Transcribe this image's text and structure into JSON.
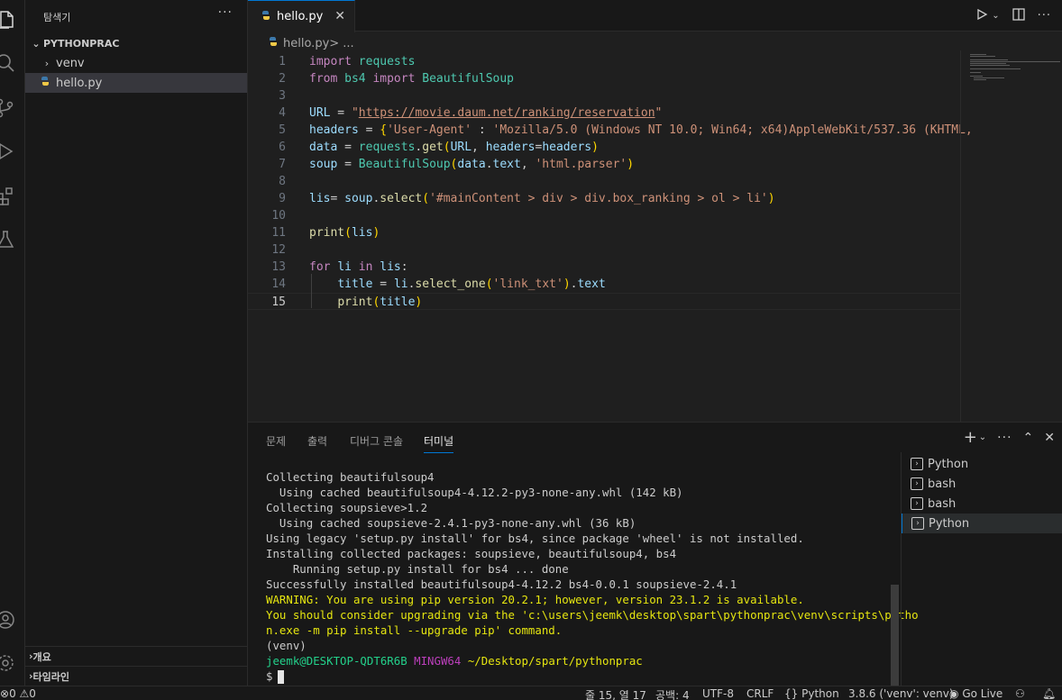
{
  "sidebar": {
    "title": "탐색기",
    "more": "···",
    "project": "PYTHONPRAC",
    "items": [
      {
        "label": "venv"
      },
      {
        "label": "hello.py"
      }
    ],
    "sections": [
      {
        "label": "개요"
      },
      {
        "label": "타임라인"
      }
    ]
  },
  "editor": {
    "tab_label": "hello.py",
    "close": "✕",
    "breadcrumb_file": "hello.py",
    "breadcrumb_rest": " > ...",
    "line_numbers": [
      "1",
      "2",
      "3",
      "4",
      "5",
      "6",
      "7",
      "8",
      "9",
      "10",
      "11",
      "12",
      "13",
      "14",
      "15"
    ],
    "current_line": "15"
  },
  "panel": {
    "tabs": [
      {
        "label": "문제"
      },
      {
        "label": "출력"
      },
      {
        "label": "디버그 콘솔"
      },
      {
        "label": "터미널"
      }
    ],
    "terminal_lines": [
      "Collecting beautifulsoup4",
      "  Using cached beautifulsoup4-4.12.2-py3-none-any.whl (142 kB)",
      "Collecting soupsieve>1.2",
      "  Using cached soupsieve-2.4.1-py3-none-any.whl (36 kB)",
      "Using legacy 'setup.py install' for bs4, since package 'wheel' is not installed.",
      "Installing collected packages: soupsieve, beautifulsoup4, bs4",
      "    Running setup.py install for bs4 ... done",
      "Successfully installed beautifulsoup4-4.12.2 bs4-0.0.1 soupsieve-2.4.1"
    ],
    "warning_lines": [
      "WARNING: You are using pip version 20.2.1; however, version 23.1.2 is available.",
      "You should consider upgrading via the 'c:\\users\\jeemk\\desktop\\spart\\pythonprac\\venv\\scripts\\pytho",
      "n.exe -m pip install --upgrade pip' command."
    ],
    "venv_line": "(venv)",
    "prompt": {
      "user": "jeemk@DESKTOP-QDT6R6B",
      "host": "MINGW64",
      "path": "~/Desktop/spart/pythonprac",
      "symbol": "$"
    },
    "terminals": [
      {
        "label": "Python"
      },
      {
        "label": "bash"
      },
      {
        "label": "bash"
      },
      {
        "label": "Python"
      }
    ]
  },
  "status": {
    "problems": "0",
    "warnings": "0",
    "position": "줄 15, 열 17",
    "spaces": "공백: 4",
    "encoding": "UTF-8",
    "eol": "CRLF",
    "language": "Python",
    "interpreter": "3.8.6 ('venv': venv)",
    "golive": "Go Live"
  },
  "colors": {
    "accent": "#0078d4",
    "keyword": "#c586c0",
    "string": "#ce9178",
    "function": "#dcdcaa",
    "variable": "#9cdcfe",
    "module": "#4ec9b0",
    "warning": "#e5e510"
  },
  "icons": [
    "explorer-icon",
    "search-icon",
    "source-control-icon",
    "run-debug-icon",
    "extensions-icon",
    "testing-icon",
    "account-icon",
    "settings-icon",
    "python-file-icon",
    "run-icon",
    "split-editor-icon",
    "new-terminal-icon",
    "chevron-down-icon",
    "maximize-panel-icon",
    "close-icon",
    "error-icon",
    "warning-icon",
    "golive-icon",
    "feedback-icon",
    "bell-icon"
  ]
}
